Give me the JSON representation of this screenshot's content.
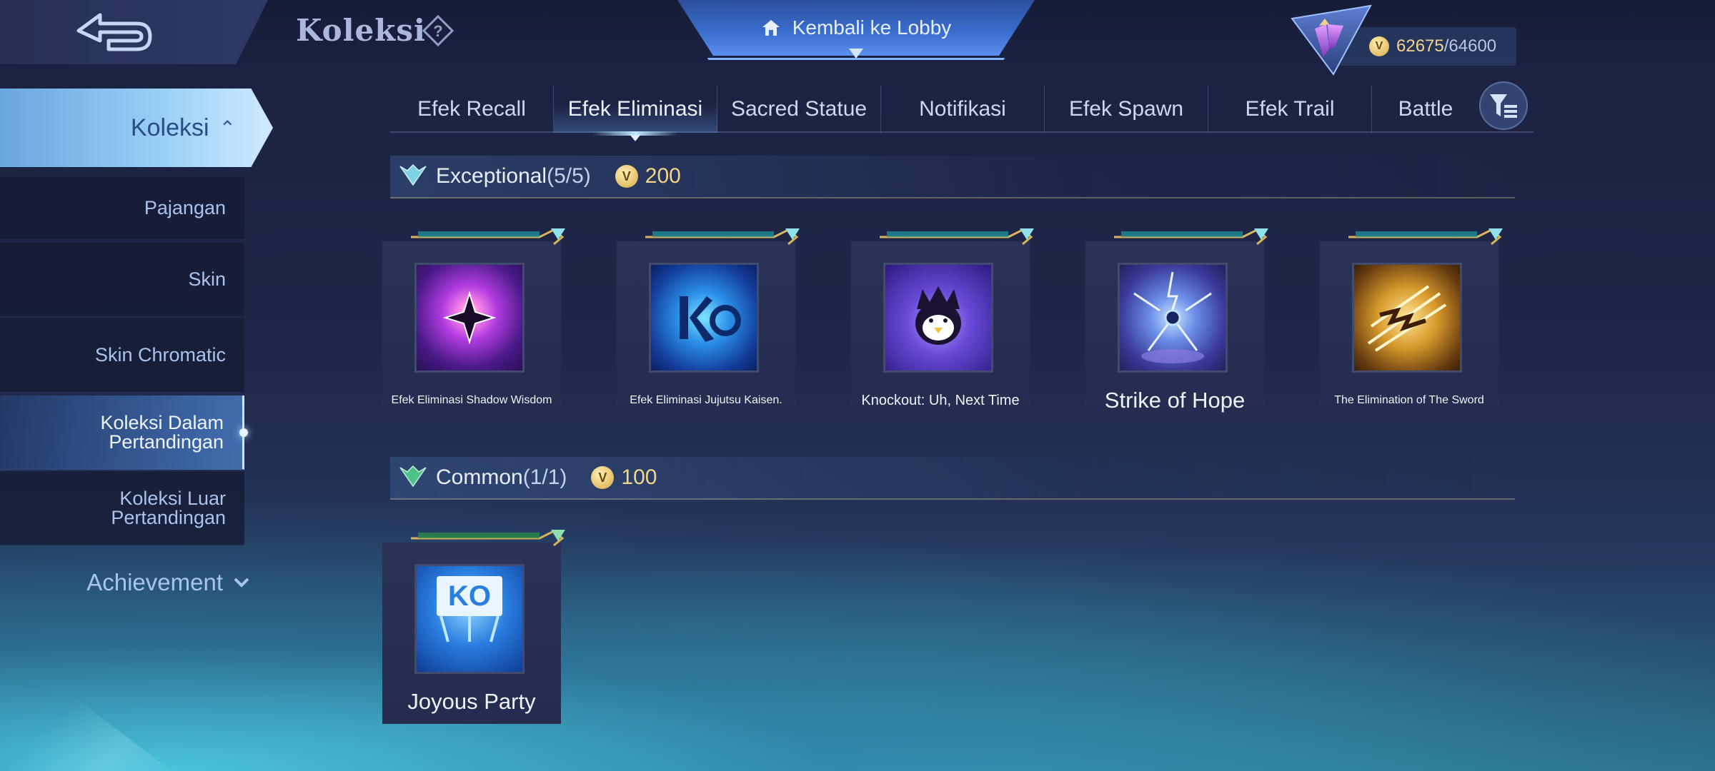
{
  "header": {
    "title": "Koleksi",
    "lobby_label": "Kembali ke Lobby",
    "points_current": "62675",
    "points_max": "/64600"
  },
  "sidebar": {
    "main": "Koleksi",
    "items": [
      {
        "label": "Pajangan"
      },
      {
        "label": "Skin"
      },
      {
        "label": "Skin Chromatic"
      },
      {
        "label": "Koleksi Dalam Pertandingan"
      },
      {
        "label": "Koleksi Luar Pertandingan"
      }
    ],
    "achievement": "Achievement"
  },
  "tabs": [
    {
      "label": "Efek Recall"
    },
    {
      "label": "Efek Eliminasi"
    },
    {
      "label": "Sacred Statue"
    },
    {
      "label": "Notifikasi"
    },
    {
      "label": "Efek Spawn"
    },
    {
      "label": "Efek Trail"
    },
    {
      "label": "Battle"
    }
  ],
  "sections": {
    "exceptional": {
      "title": "Exceptional",
      "count": "(5/5)",
      "price": "200"
    },
    "common": {
      "title": "Common",
      "count": "(1/1)",
      "price": "100"
    }
  },
  "items": {
    "exceptional": [
      {
        "name": "Efek Eliminasi Shadow Wisdom"
      },
      {
        "name": "Efek Eliminasi Jujutsu Kaisen."
      },
      {
        "name": "Knockout: Uh, Next Time"
      },
      {
        "name": "Strike of Hope"
      },
      {
        "name": "The Elimination of The Sword"
      }
    ],
    "common": [
      {
        "name": "Joyous Party",
        "thumb_text": "KO"
      }
    ]
  },
  "colors": {
    "accent_gold": "#f2d58a",
    "active_blue": "#9ad0f6",
    "text_light": "#dfe6f5"
  }
}
